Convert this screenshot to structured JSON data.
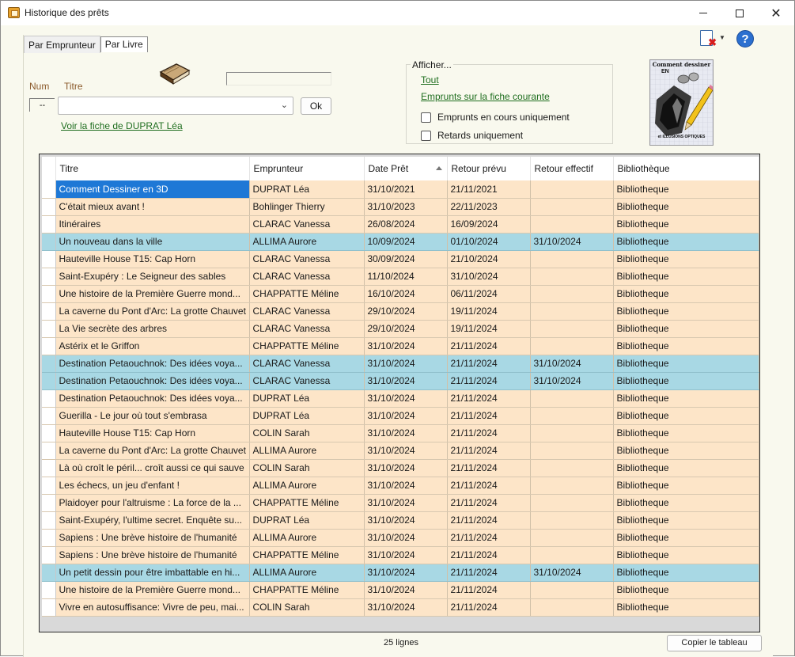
{
  "window": {
    "title": "Historique des prêts"
  },
  "tabs": [
    "Par Emprunteur",
    "Par Livre"
  ],
  "form": {
    "num_label": "Num",
    "titre_label": "Titre",
    "num_value": "--",
    "ok_label": "Ok",
    "voir_fiche_link": "Voir la fiche de DUPRAT Léa"
  },
  "afficher": {
    "legend": "Afficher...",
    "tout_link": "Tout",
    "fiche_link": "Emprunts sur la fiche courante",
    "checkbox_en_cours": "Emprunts en cours uniquement",
    "checkbox_retards": "Retards uniquement"
  },
  "cover": {
    "line1": "Comment dessiner",
    "line2": "EN",
    "line3": "et ILLUSIONS OPTIQUES"
  },
  "table": {
    "columns": [
      "Titre",
      "Emprunteur",
      "Date Prêt",
      "Retour prévu",
      "Retour effectif",
      "Bibliothèque"
    ],
    "rows": [
      [
        "Comment Dessiner en 3D",
        "DUPRAT Léa",
        "31/10/2021",
        "21/11/2021",
        "",
        "Bibliotheque"
      ],
      [
        "C'était mieux avant !",
        "Bohlinger Thierry",
        "31/10/2023",
        "22/11/2023",
        "",
        "Bibliotheque"
      ],
      [
        "Itinéraires",
        "CLARAC Vanessa",
        "26/08/2024",
        "16/09/2024",
        "",
        "Bibliotheque"
      ],
      [
        "Un nouveau dans la ville",
        "ALLIMA Aurore",
        "10/09/2024",
        "01/10/2024",
        "31/10/2024",
        "Bibliotheque"
      ],
      [
        "Hauteville House T15: Cap Horn",
        "CLARAC Vanessa",
        "30/09/2024",
        "21/10/2024",
        "",
        "Bibliotheque"
      ],
      [
        "Saint-Exupéry : Le Seigneur des sables",
        "CLARAC Vanessa",
        "11/10/2024",
        "31/10/2024",
        "",
        "Bibliotheque"
      ],
      [
        "Une histoire de la Première Guerre mond...",
        "CHAPPATTE Méline",
        "16/10/2024",
        "06/11/2024",
        "",
        "Bibliotheque"
      ],
      [
        "La caverne du Pont d'Arc: La grotte Chauvet",
        "CLARAC Vanessa",
        "29/10/2024",
        "19/11/2024",
        "",
        "Bibliotheque"
      ],
      [
        "La Vie secrète des arbres",
        "CLARAC Vanessa",
        "29/10/2024",
        "19/11/2024",
        "",
        "Bibliotheque"
      ],
      [
        "Astérix et le Griffon",
        "CHAPPATTE Méline",
        "31/10/2024",
        "21/11/2024",
        "",
        "Bibliotheque"
      ],
      [
        "Destination Petaouchnok: Des idées voya...",
        "CLARAC Vanessa",
        "31/10/2024",
        "21/11/2024",
        "31/10/2024",
        "Bibliotheque"
      ],
      [
        "Destination Petaouchnok: Des idées voya...",
        "CLARAC Vanessa",
        "31/10/2024",
        "21/11/2024",
        "31/10/2024",
        "Bibliotheque"
      ],
      [
        "Destination Petaouchnok: Des idées voya...",
        "DUPRAT Léa",
        "31/10/2024",
        "21/11/2024",
        "",
        "Bibliotheque"
      ],
      [
        "Guerilla - Le jour où tout s'embrasa",
        "DUPRAT Léa",
        "31/10/2024",
        "21/11/2024",
        "",
        "Bibliotheque"
      ],
      [
        "Hauteville House T15: Cap Horn",
        "COLIN Sarah",
        "31/10/2024",
        "21/11/2024",
        "",
        "Bibliotheque"
      ],
      [
        "La caverne du Pont d'Arc: La grotte Chauvet",
        "ALLIMA Aurore",
        "31/10/2024",
        "21/11/2024",
        "",
        "Bibliotheque"
      ],
      [
        "Là où croît le péril... croît aussi ce qui sauve",
        "COLIN Sarah",
        "31/10/2024",
        "21/11/2024",
        "",
        "Bibliotheque"
      ],
      [
        "Les échecs, un jeu d'enfant !",
        "ALLIMA Aurore",
        "31/10/2024",
        "21/11/2024",
        "",
        "Bibliotheque"
      ],
      [
        "Plaidoyer pour l'altruisme : La force de la ...",
        "CHAPPATTE Méline",
        "31/10/2024",
        "21/11/2024",
        "",
        "Bibliotheque"
      ],
      [
        "Saint-Exupéry, l'ultime secret. Enquête su...",
        "DUPRAT Léa",
        "31/10/2024",
        "21/11/2024",
        "",
        "Bibliotheque"
      ],
      [
        "Sapiens : Une brève histoire de l'humanité",
        "ALLIMA Aurore",
        "31/10/2024",
        "21/11/2024",
        "",
        "Bibliotheque"
      ],
      [
        "Sapiens : Une brève histoire de l'humanité",
        "CHAPPATTE Méline",
        "31/10/2024",
        "21/11/2024",
        "",
        "Bibliotheque"
      ],
      [
        "Un petit dessin pour être imbattable en hi...",
        "ALLIMA Aurore",
        "31/10/2024",
        "21/11/2024",
        "31/10/2024",
        "Bibliotheque"
      ],
      [
        "Une histoire de la Première Guerre mond...",
        "CHAPPATTE Méline",
        "31/10/2024",
        "21/11/2024",
        "",
        "Bibliotheque"
      ],
      [
        "Vivre en autosuffisance: Vivre de peu, mai...",
        "COLIN Sarah",
        "31/10/2024",
        "21/11/2024",
        "",
        "Bibliotheque"
      ]
    ],
    "returned_row_color": "#a8d8e4",
    "default_row_color": "#fde5c8",
    "selected_cell_color": "#1e78d6"
  },
  "footer": {
    "count_label": "25 lignes",
    "copy_button": "Copier le tableau"
  },
  "icons": {
    "app": "library-app-icon",
    "export": "document-delete-icon",
    "help": "help-icon",
    "book": "book-icon"
  }
}
